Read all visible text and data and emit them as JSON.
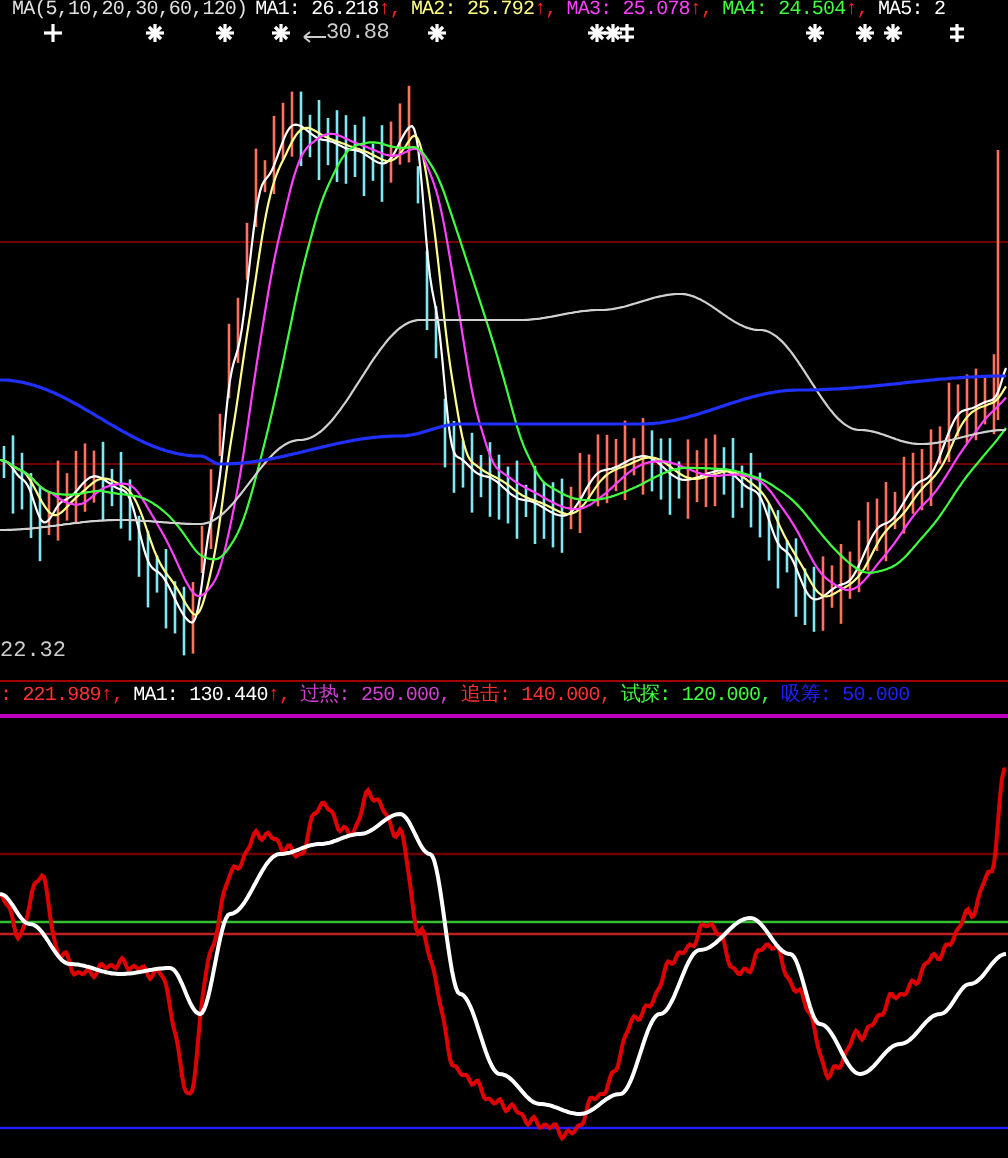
{
  "price_panel": {
    "legend": {
      "title": "MA(5,10,20,30,60,120)",
      "items": [
        {
          "text": "MA1: 26.218",
          "arrow": "↑,",
          "color": "#ffffff"
        },
        {
          "text": "MA2: 25.792",
          "arrow": "↑,",
          "color": "#ffff80"
        },
        {
          "text": "MA3: 25.078",
          "arrow": "↑,",
          "color": "#ff40ff"
        },
        {
          "text": "MA4: 24.504",
          "arrow": "↑,",
          "color": "#40ff40"
        },
        {
          "text": "MA5: 2",
          "color": "#ffffff"
        }
      ]
    },
    "markers": [
      {
        "kind": "cross"
      },
      {
        "kind": "star"
      },
      {
        "kind": "star"
      },
      {
        "kind": "star"
      },
      {
        "kind": "star"
      },
      {
        "kind": "star"
      },
      {
        "kind": "star"
      },
      {
        "kind": "double"
      },
      {
        "kind": "star"
      },
      {
        "kind": "star"
      },
      {
        "kind": "star"
      },
      {
        "kind": "double"
      }
    ],
    "high_label": "30.88",
    "low_label": "22.32"
  },
  "indicator_panel": {
    "legend": {
      "items": [
        {
          "text": ": 221.989",
          "arrow": "↑,",
          "color": "#ff3030"
        },
        {
          "text": "MA1: 130.440",
          "arrow": "↑,",
          "color": "#ffffff"
        },
        {
          "text": "过热: 250.000,",
          "color": "#d040d0"
        },
        {
          "text": "追击: 140.000,",
          "color": "#ff3030"
        },
        {
          "text": "试探: 120.000,",
          "color": "#40ff40"
        },
        {
          "text": "吸筹: 50.000",
          "color": "#2020ff"
        }
      ]
    }
  }
}
